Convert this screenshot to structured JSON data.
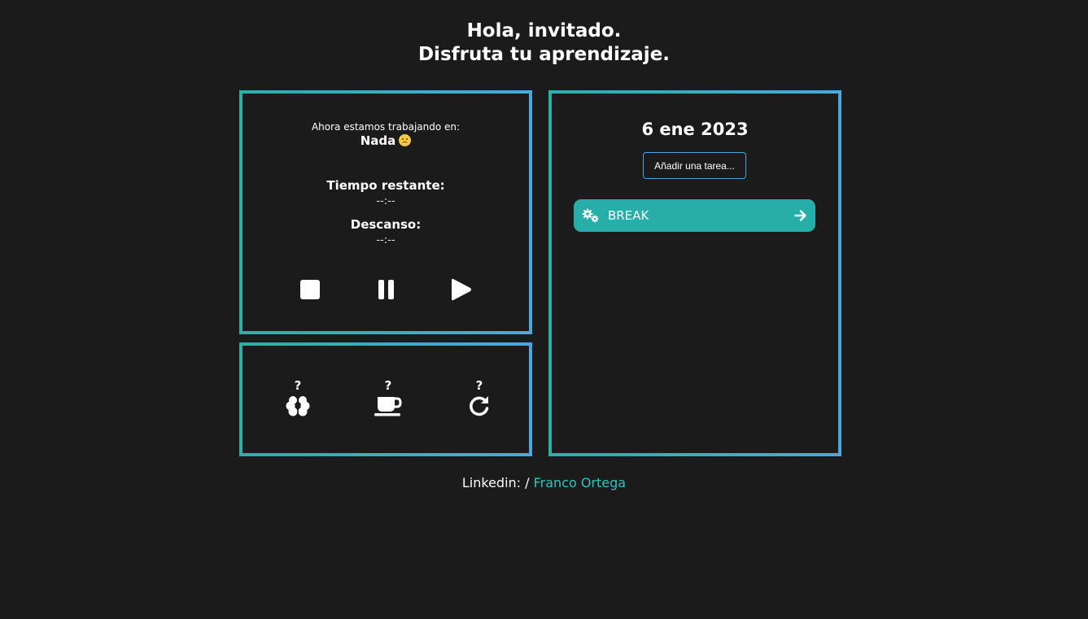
{
  "greeting": {
    "line1": "Hola, invitado.",
    "line2": "Disfruta tu aprendizaje."
  },
  "timer": {
    "working_on_label": "Ahora estamos trabajando en:",
    "current_task": "Nada",
    "current_task_emoji": "sad-face-icon",
    "remaining_label": "Tiempo restante:",
    "remaining_value": "--:--",
    "break_label": "Descanso:",
    "break_value": "--:--",
    "controls": [
      "stop-icon",
      "pause-icon",
      "play-icon"
    ]
  },
  "stats": [
    {
      "value": "?",
      "icon": "brain-icon"
    },
    {
      "value": "?",
      "icon": "coffee-cup-icon"
    },
    {
      "value": "?",
      "icon": "redo-icon"
    }
  ],
  "tasks": {
    "date": "6 ene 2023",
    "input_placeholder": "Añadir una tarea...",
    "items": [
      {
        "label": "BREAK",
        "icon": "gears-icon",
        "action_icon": "arrow-right-icon"
      }
    ]
  },
  "footer": {
    "prefix": "Linkedin: /",
    "link_text": "Franco Ortega"
  },
  "colors": {
    "background": "#1b1b1b",
    "accent": "#27aea8",
    "border_gradient_start": "#2bb0a6",
    "border_gradient_end": "#4aa8e0",
    "link": "#2ec4c0"
  }
}
